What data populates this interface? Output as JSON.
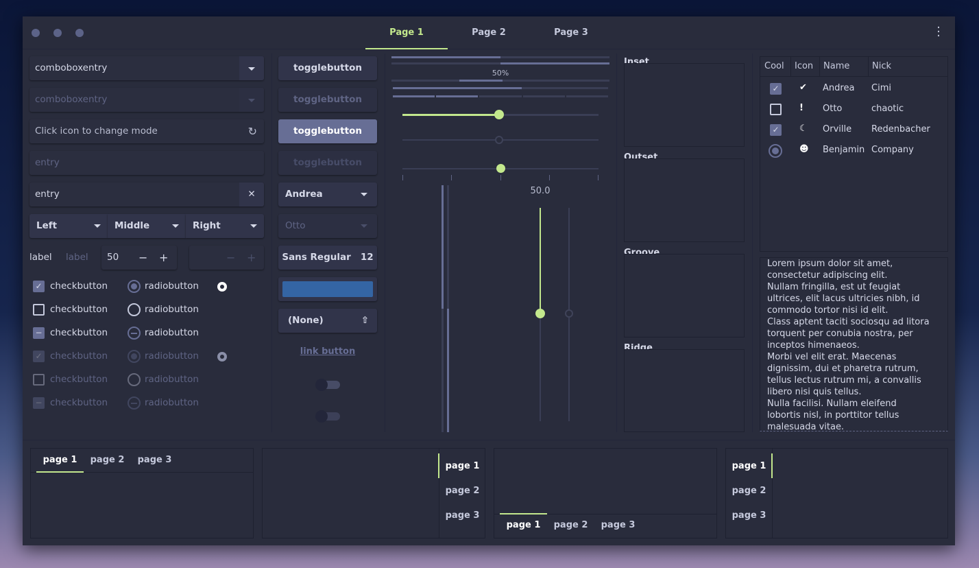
{
  "titlebar": {
    "tabs": [
      "Page 1",
      "Page 2",
      "Page 3"
    ],
    "active_tab": 0,
    "menu_icon": "kebab-menu-icon"
  },
  "colors": {
    "accent": "#c3e88d",
    "selection": "#676e95",
    "color_button": "#3465a4",
    "window_bg": "#292c3c"
  },
  "entries": {
    "combo1": "comboboxentry",
    "combo2": "comboboxentry",
    "mode": "Click icon to change mode",
    "entry_disabled": "entry",
    "entry": "entry"
  },
  "combos": {
    "left": "Left",
    "middle": "Middle",
    "right": "Right"
  },
  "labels": {
    "label1": "label",
    "label2": "label"
  },
  "spin": {
    "value": "50",
    "minus": "−",
    "plus": "+"
  },
  "checks": {
    "label": "checkbutton",
    "radio_label": "radiobutton"
  },
  "col2": {
    "toggle": "togglebutton",
    "combo_andrea": "Andrea",
    "combo_otto": "Otto",
    "font_name": "Sans Regular",
    "font_size": "12",
    "file": "(None)",
    "link": "link button"
  },
  "progress": {
    "label": "50%",
    "value": 0.5
  },
  "scales": {
    "value": 50,
    "value_label": "50.0"
  },
  "frames": {
    "inset": "Inset",
    "outset": "Outset",
    "groove": "Groove",
    "ridge": "Ridge"
  },
  "tree": {
    "headers": [
      "Cool",
      "Icon",
      "Name",
      "Nick"
    ],
    "rows": [
      {
        "cool": "checked",
        "icon": "check-circle-icon",
        "name": "Andrea",
        "nick": "Cimi"
      },
      {
        "cool": "unchecked",
        "icon": "exclamation-icon",
        "name": "Otto",
        "nick": "chaotic"
      },
      {
        "cool": "checked",
        "icon": "moon-icon",
        "name": "Orville",
        "nick": "Redenbacher"
      },
      {
        "cool": "radio",
        "icon": "monkey-icon",
        "name": "Benjamin",
        "nick": "Company"
      }
    ]
  },
  "textview": [
    "Lorem ipsum dolor sit amet,",
    "consectetur adipiscing elit.",
    "Nullam fringilla, est ut feugiat",
    "ultrices, elit lacus ultricies nibh, id",
    "commodo tortor nisi id elit.",
    "Class aptent taciti sociosqu ad litora",
    "torquent per conubia nostra, per",
    "inceptos himenaeos.",
    "Morbi vel elit erat. Maecenas",
    "dignissim, dui et pharetra rutrum,",
    "tellus lectus rutrum mi, a convallis",
    "libero nisi quis tellus.",
    "Nulla facilisi. Nullam eleifend",
    "lobortis nisl, in porttitor tellus",
    "malesuada vitae."
  ],
  "notebooks": {
    "tabs": [
      "page 1",
      "page 2",
      "page 3"
    ]
  }
}
